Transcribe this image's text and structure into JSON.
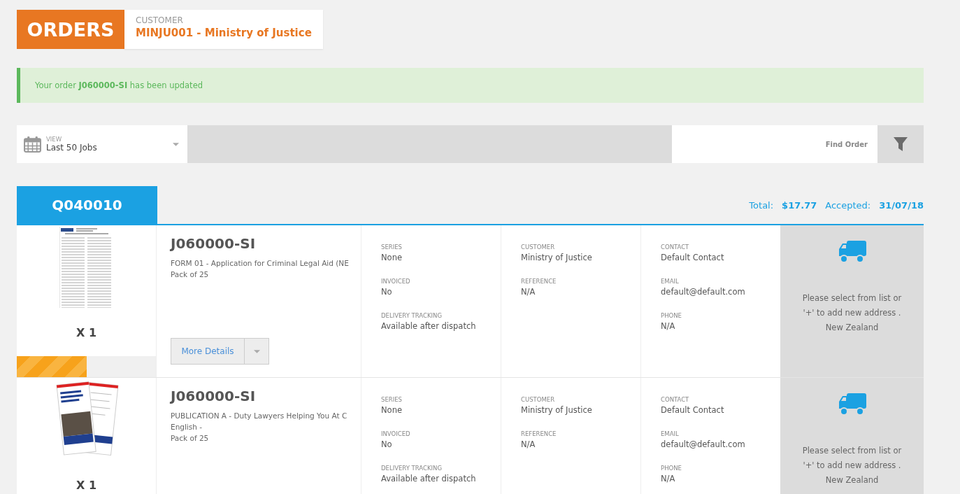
{
  "header": {
    "title": "ORDERS",
    "customer_label": "CUSTOMER",
    "customer": "MINJU001 - Ministry of Justice"
  },
  "alert": {
    "text": "Your order **J060000-SI** has been updated"
  },
  "toolbar": {
    "view_label": "VIEW",
    "view_value": "Last 50 Jobs",
    "search": {
      "placeholder": "Find Order"
    }
  },
  "quote": {
    "number": "Q040010",
    "total_label": "Total:",
    "total": "$17.77",
    "accepted_label": "Accepted:",
    "accepted": "31/07/18"
  },
  "jobs": [
    {
      "kind": "form",
      "quantity": "X 1",
      "level": 0.5,
      "job": "J060000-SI",
      "description": [
        "FORM 01 - Application for Criminal Legal Aid (NE",
        "Pack of 25"
      ],
      "button": "More Details",
      "fields": [
        [
          {
            "label": "SERIES",
            "value": "None"
          },
          {
            "label": "INVOICED",
            "value": "No"
          },
          {
            "label": "DELIVERY TRACKING",
            "value": "Available after dispatch"
          }
        ],
        [
          {
            "label": "CUSTOMER",
            "value": "Ministry of Justice"
          },
          {
            "label": "REFERENCE",
            "value": "N/A"
          }
        ],
        [
          {
            "label": "CONTACT",
            "value": "Default Contact"
          },
          {
            "label": "EMAIL",
            "value": "default@default.com"
          },
          {
            "label": "PHONE",
            "value": "N/A"
          }
        ]
      ],
      "address": "Please select from list or '+' to add new address .",
      "country": "New Zealand"
    },
    {
      "kind": "brochure",
      "quantity": "X 1",
      "job": "J060000-SI",
      "description": [
        "PUBLICATION A - Duty Lawyers Helping You At C",
        "English -",
        "Pack of 25"
      ],
      "fields": [
        [
          {
            "label": "SERIES",
            "value": "None"
          },
          {
            "label": "INVOICED",
            "value": "No"
          },
          {
            "label": "DELIVERY TRACKING",
            "value": "Available after dispatch"
          }
        ],
        [
          {
            "label": "CUSTOMER",
            "value": "Ministry of Justice"
          },
          {
            "label": "REFERENCE",
            "value": "N/A"
          }
        ],
        [
          {
            "label": "CONTACT",
            "value": "Default Contact"
          },
          {
            "label": "EMAIL",
            "value": "default@default.com"
          },
          {
            "label": "PHONE",
            "value": "N/A"
          }
        ]
      ],
      "address": "Please select from list or '+' to add new address .",
      "country": "New Zealand"
    }
  ]
}
